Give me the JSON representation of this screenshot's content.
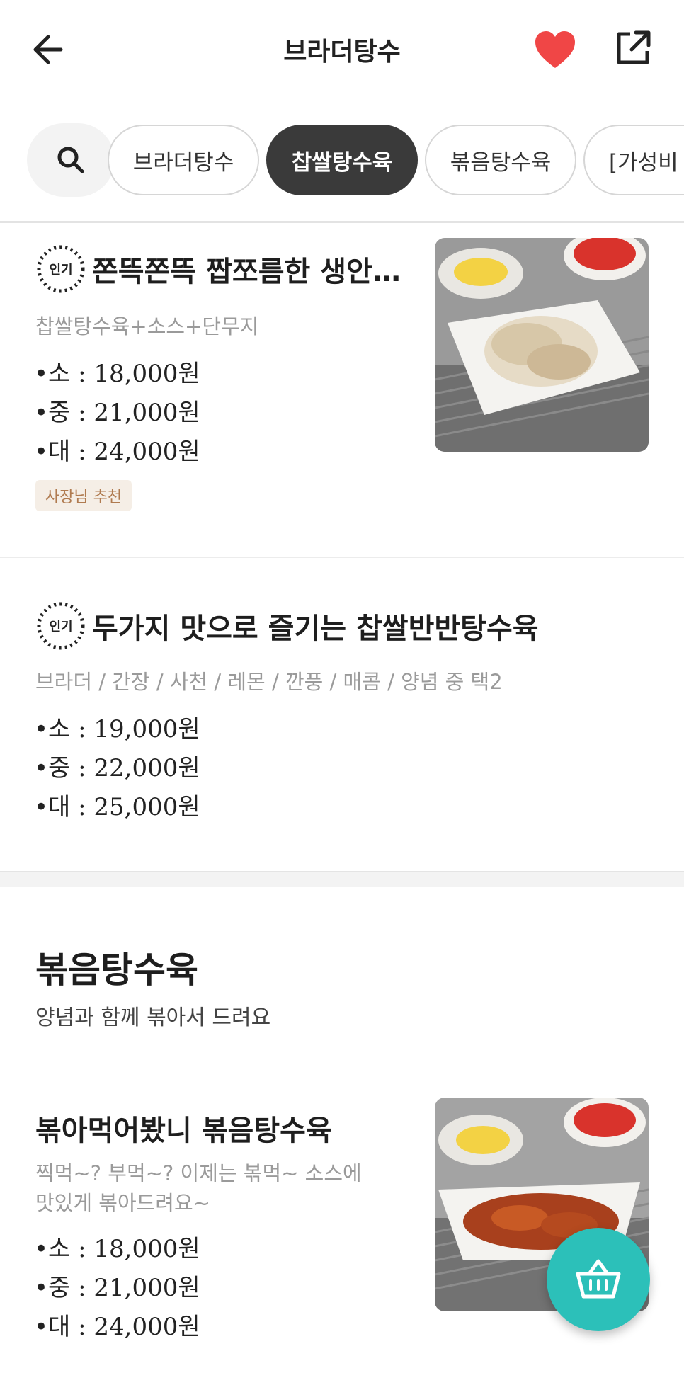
{
  "header": {
    "title": "브라더탕수"
  },
  "colors": {
    "accent": "#2cc0b9",
    "heart": "#f04646",
    "active_chip": "#3a3a3a",
    "owner_badge_bg": "#f5eee6",
    "owner_badge_text": "#b07b50"
  },
  "icons": {
    "back": "arrow-left-icon",
    "favorite": "heart-icon",
    "share": "share-icon",
    "search": "search-icon",
    "cart": "basket-icon"
  },
  "tabs": [
    {
      "label": "브라더탕수",
      "active": false
    },
    {
      "label": "찹쌀탕수육",
      "active": true
    },
    {
      "label": "볶음탕수육",
      "active": false
    },
    {
      "label": "[가성비",
      "active": false
    }
  ],
  "items": [
    {
      "popular_badge": "인기",
      "name": "쫀뜩쫀뜩 짭쪼름한 생안…",
      "description": "찹쌀탕수육+소스+단무지",
      "prices": [
        "•소 : 18,000원",
        "•중 : 21,000원",
        "•대 : 24,000원"
      ],
      "owner_badge": "사장님 추천"
    },
    {
      "popular_badge": "인기",
      "name": "두가지 맛으로 즐기는 찹쌀반반탕수육",
      "description": "브라더 / 간장 / 사천 / 레몬 / 깐풍 / 매콤 / 양념 중 택2",
      "prices": [
        "•소 : 19,000원",
        "•중 : 22,000원",
        "•대 : 25,000원"
      ]
    }
  ],
  "section": {
    "title": "볶음탕수육",
    "subtitle": "양념과 함께 볶아서 드려요",
    "item": {
      "name": "볶아먹어봤니 볶음탕수육",
      "description_line1": "찍먹~? 부먹~? 이제는 볶먹~ 소스에",
      "description_line2": "맛있게 볶아드려요~",
      "prices": [
        "•소 : 18,000원",
        "•중 : 21,000원",
        "•대 : 24,000원"
      ]
    }
  }
}
